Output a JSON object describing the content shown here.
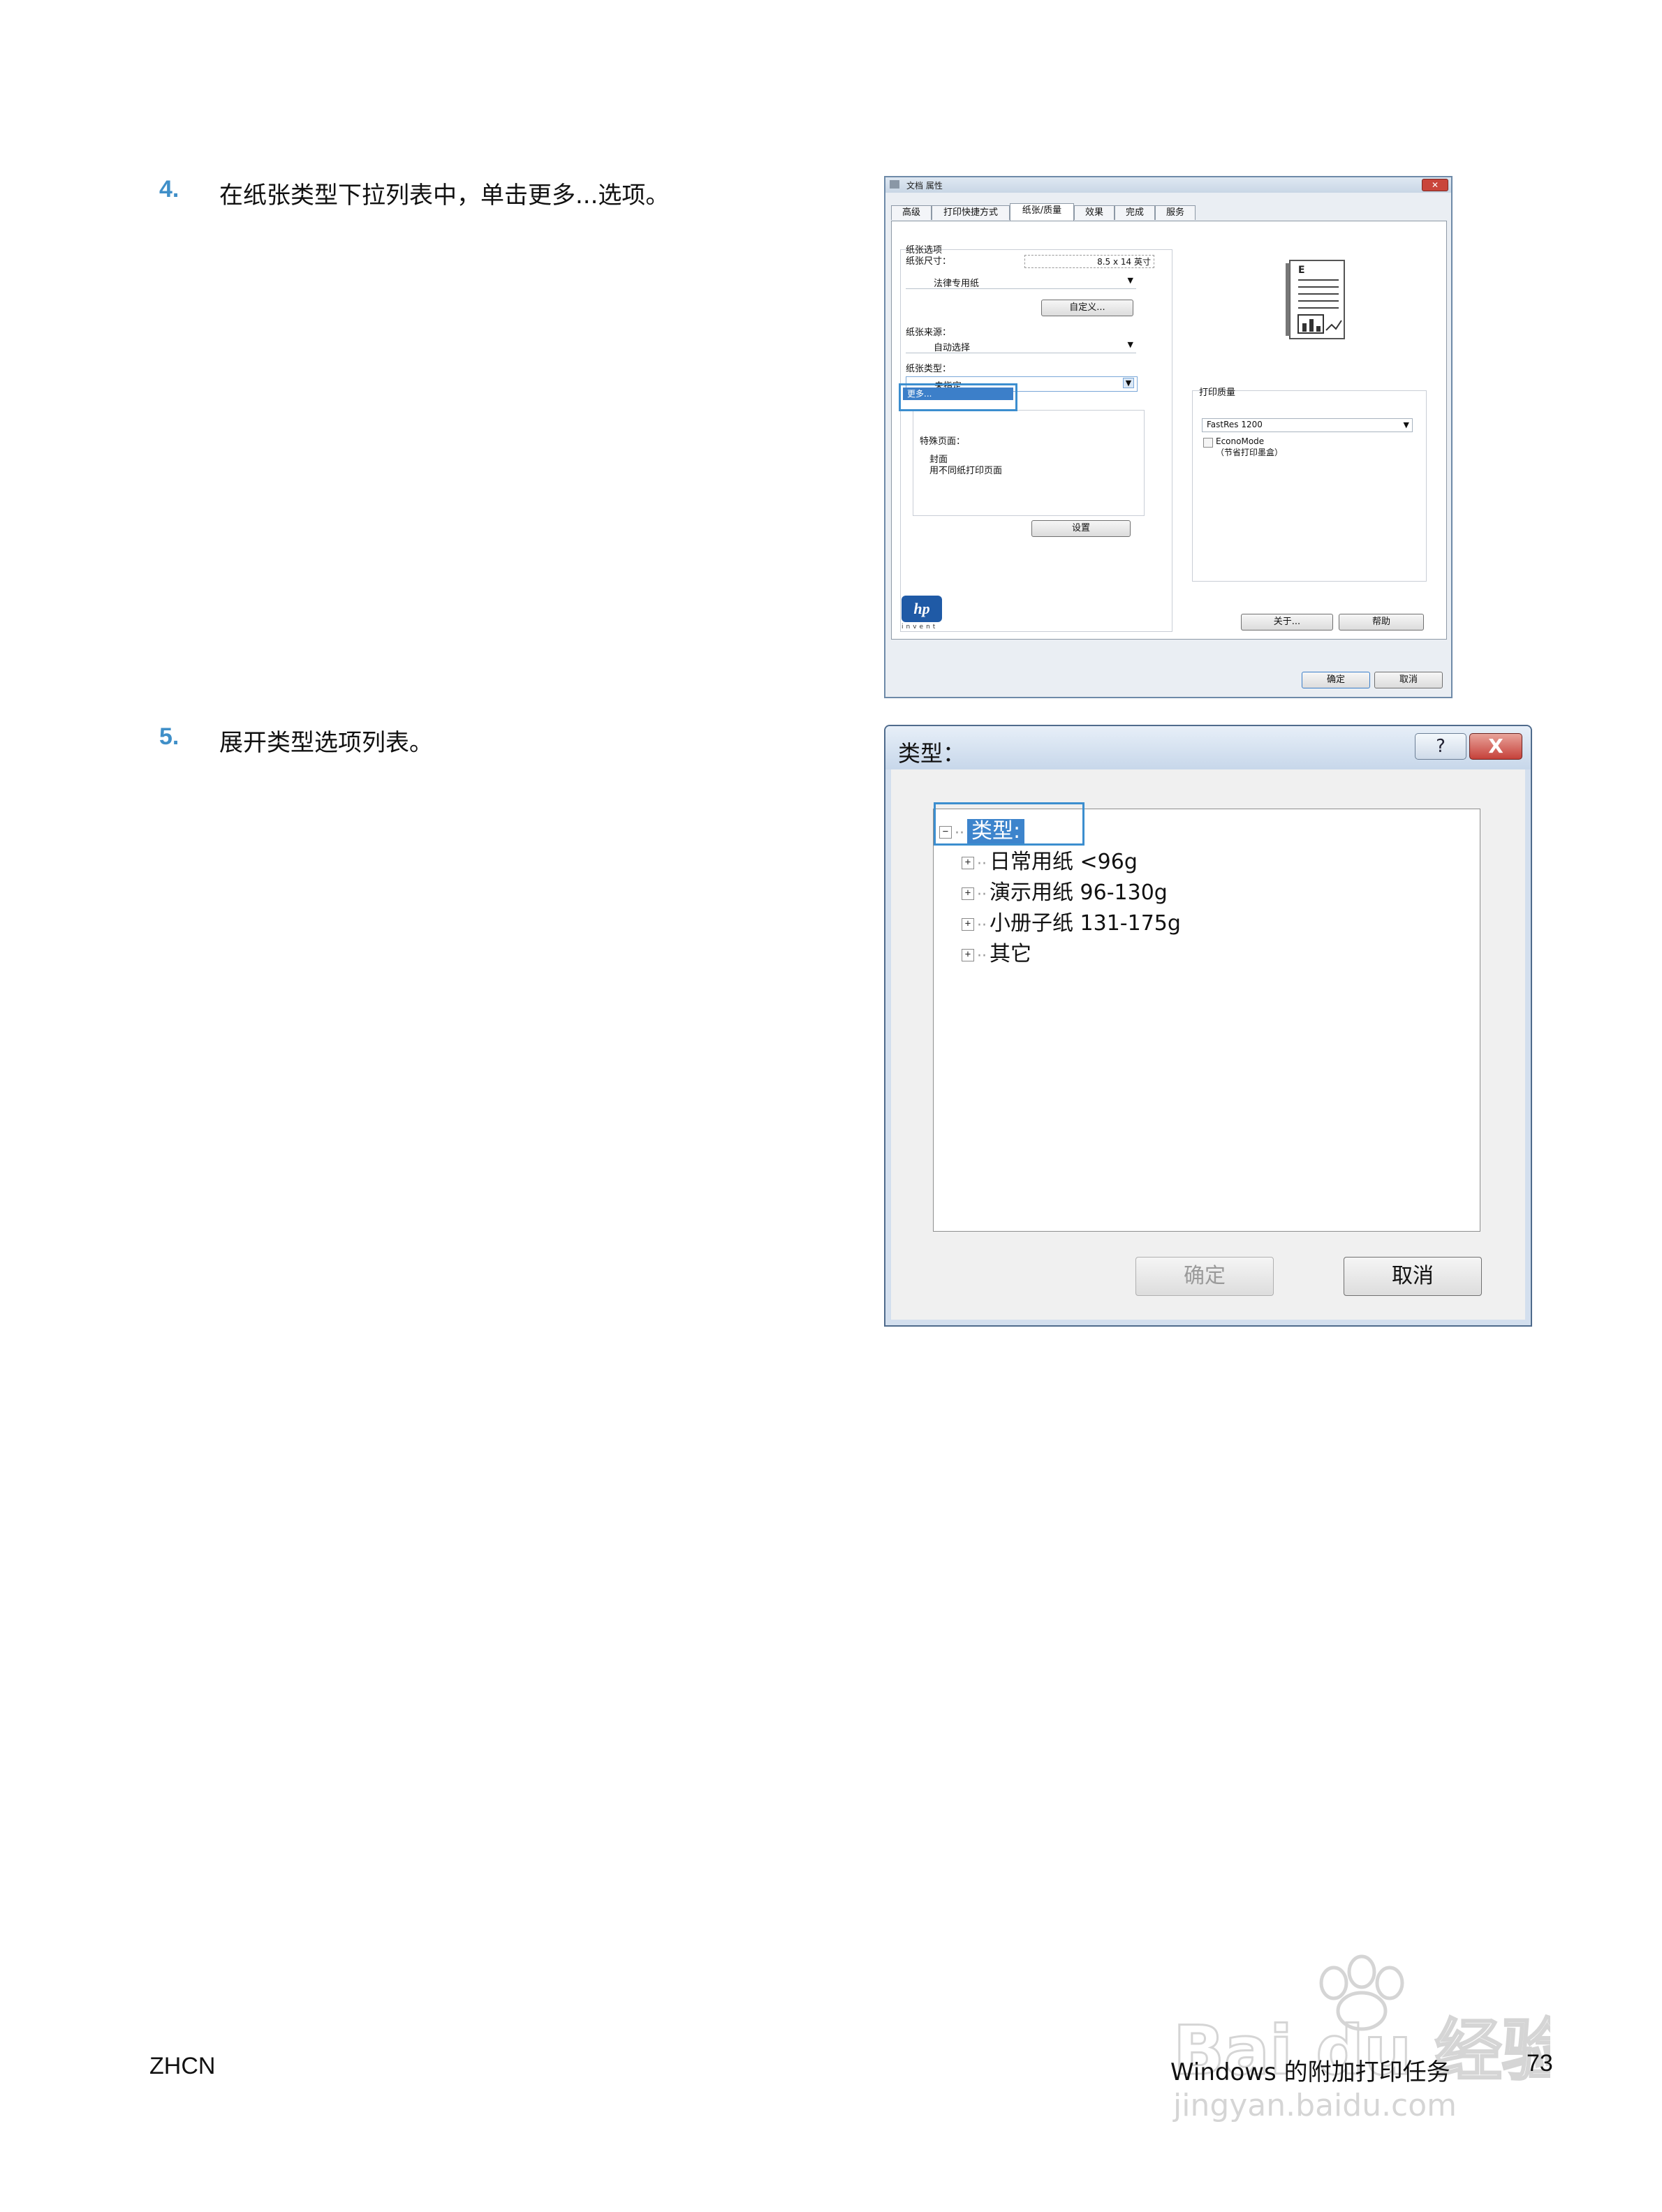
{
  "steps": [
    {
      "num": "4.",
      "text": "在纸张类型下拉列表中，单击更多...选项。"
    },
    {
      "num": "5.",
      "text": "展开类型选项列表。"
    }
  ],
  "dialog1": {
    "title": "文档 属性",
    "tabs": [
      "高级",
      "打印快捷方式",
      "纸张/质量",
      "效果",
      "完成",
      "服务"
    ],
    "paper_options_label": "纸张选项",
    "paper_size_label": "纸张尺寸：",
    "paper_size_value": "8.5 x 14 英寸",
    "paper_size_combo": "法律专用纸",
    "custom_button": "自定义...",
    "paper_source_label": "纸张来源：",
    "paper_source_value": "自动选择",
    "paper_type_label": "纸张类型：",
    "paper_type_value": "未指定",
    "dropdown_option": "更多...",
    "special_pages_label": "特殊页面：",
    "special_pages_items": [
      "封面",
      "用不同纸打印页面"
    ],
    "settings_button": "设置",
    "print_quality_label": "打印质量",
    "print_quality_value": "FastRes 1200",
    "econo_mode_label": "EconoMode",
    "econo_mode_note": "（节省打印墨盒）",
    "about_button": "关于...",
    "help_button": "帮助",
    "ok_button": "确定",
    "cancel_button": "取消",
    "logo_text": "hp",
    "logo_sub": "invent"
  },
  "dialog2": {
    "title": "类型：",
    "help_glyph": "?",
    "close_glyph": "X",
    "root_label": "类型:",
    "items": [
      "日常用纸 <96g",
      "演示用纸 96-130g",
      "小册子纸 131-175g",
      "其它"
    ],
    "ok_button": "确定",
    "cancel_button": "取消"
  },
  "footer": {
    "left": "ZHCN",
    "right": "Windows 的附加打印任务",
    "page": "73"
  },
  "watermark": {
    "text": "Bai du 经验",
    "url": "jingyan.baidu.com"
  }
}
